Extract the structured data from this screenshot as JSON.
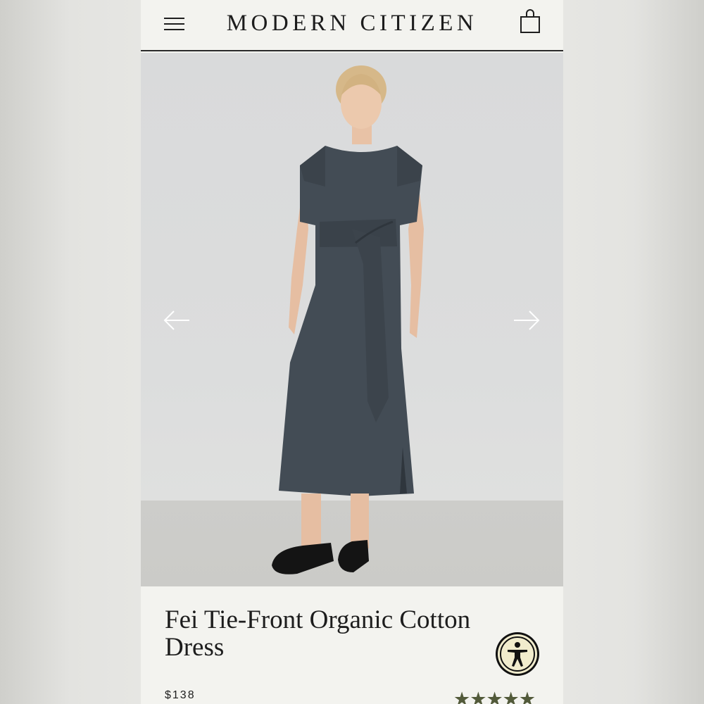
{
  "header": {
    "brand": "MODERN CITIZEN",
    "menu_icon": "hamburger-menu-icon",
    "bag_icon": "shopping-bag-icon"
  },
  "gallery": {
    "image_subject": "model wearing charcoal tie-front midi dress",
    "prev_icon": "arrow-left-icon",
    "next_icon": "arrow-right-icon"
  },
  "product": {
    "title": "Fei Tie-Front Organic Cotton Dress",
    "price": "$138",
    "rating": 5,
    "rating_max": 5
  },
  "accessibility": {
    "icon": "accessibility-icon"
  },
  "colors": {
    "background": "#f3f3ef",
    "text": "#1d1d1d",
    "star": "#525a3a",
    "dress": "#434c55"
  }
}
